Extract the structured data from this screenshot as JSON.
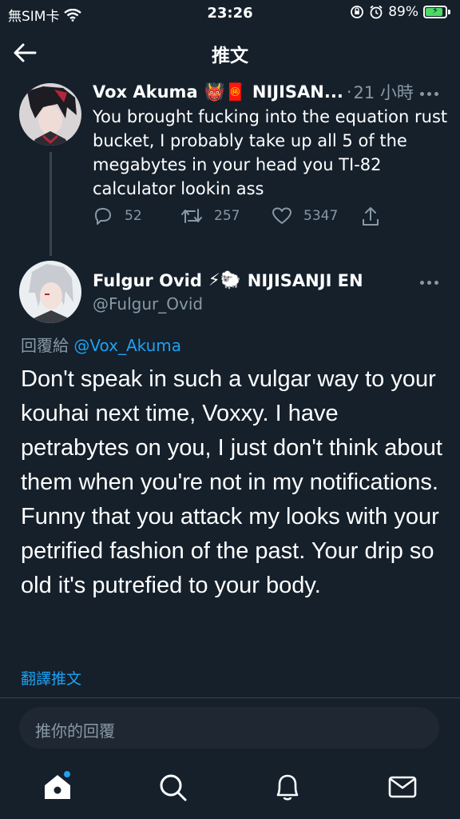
{
  "status_bar": {
    "carrier": "無SIM卡",
    "time": "23:26",
    "battery": "89%",
    "battery_level": 0.89
  },
  "nav": {
    "title": "推文"
  },
  "parent_tweet": {
    "name": "Vox Akuma",
    "emoji": "👹🧧",
    "org": "NIJISAN...",
    "separator": "·",
    "time": "21 小時",
    "text": "You brought fucking into the equation rust bucket, I probably take up all 5 of the megabytes in your head you TI-82 calculator lookin ass",
    "replies": "52",
    "retweets": "257",
    "likes": "5347"
  },
  "main_tweet": {
    "name": "Fulgur Ovid",
    "emoji": "⚡🐑",
    "org": "NIJISANJI EN",
    "handle": "@Fulgur_Ovid",
    "reply_prefix": "回覆給",
    "reply_handle": "@Vox_Akuma",
    "text": "Don't speak in such a vulgar way to your kouhai next time, Voxxy. I have petrabytes on you, I just don't think about them when you're not in my notifications. Funny that you attack my looks with your petrified fashion of the past. Your drip so old it's putrefied to your body.",
    "translate": "翻譯推文"
  },
  "reply_bar": {
    "placeholder": "推你的回覆"
  },
  "colors": {
    "background": "#15202b",
    "muted": "#8899a6",
    "accent": "#1da1f2",
    "divider": "#38444d"
  },
  "tabbar": {
    "items": [
      "home-icon",
      "search-icon",
      "bell-icon",
      "mail-icon"
    ]
  }
}
